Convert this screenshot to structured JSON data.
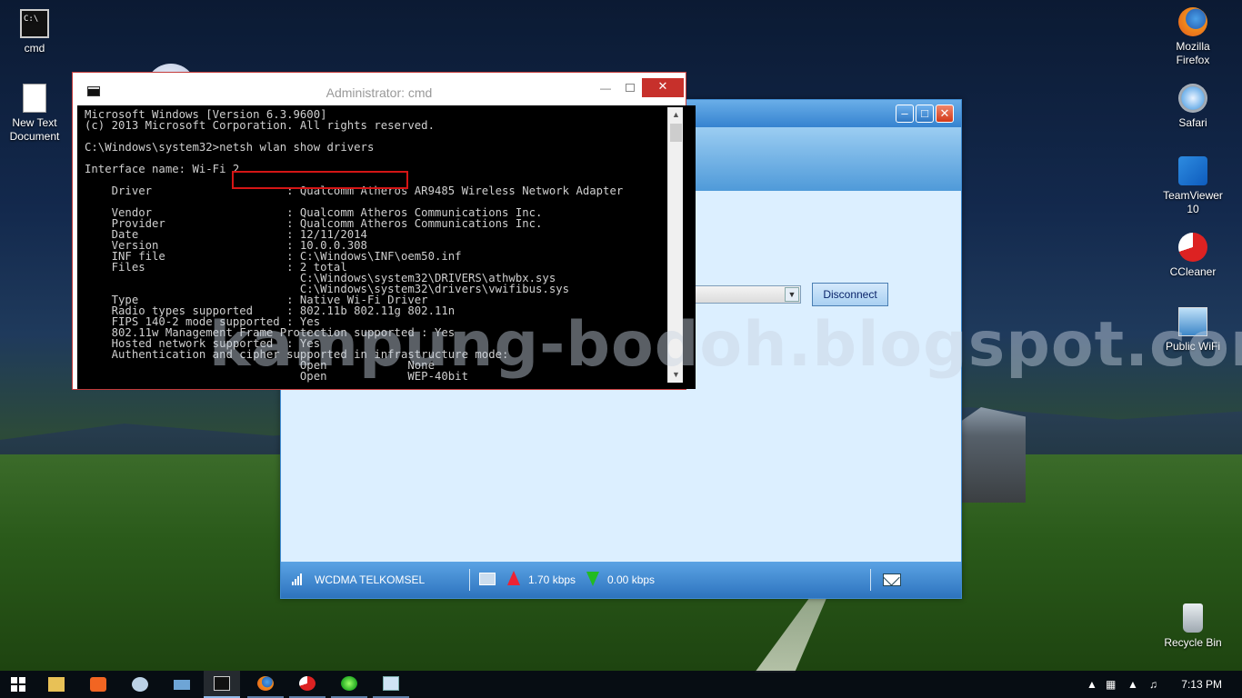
{
  "desktop": {
    "icons": [
      {
        "label": "cmd"
      },
      {
        "label": "New Text Document"
      },
      {
        "label": "Mozilla Firefox"
      },
      {
        "label": "Safari"
      },
      {
        "label": "TeamViewer 10"
      },
      {
        "label": "CCleaner"
      },
      {
        "label": "Public WiFi"
      },
      {
        "label": "Recycle Bin"
      }
    ],
    "watermark": "kampung-bodoh.blogspot.com"
  },
  "cmd_window": {
    "title": "Administrator: cmd",
    "close_label": "✕",
    "console_lines": [
      "Microsoft Windows [Version 6.3.9600]",
      "(c) 2013 Microsoft Corporation. All rights reserved.",
      "",
      "C:\\Windows\\system32>netsh wlan show drivers",
      "",
      "Interface name: Wi-Fi 2",
      "",
      "    Driver                    : Qualcomm Atheros AR9485 Wireless Network Adapter",
      "",
      "    Vendor                    : Qualcomm Atheros Communications Inc.",
      "    Provider                  : Qualcomm Atheros Communications Inc.",
      "    Date                      : 12/11/2014",
      "    Version                   : 10.0.0.308",
      "    INF file                  : C:\\Windows\\INF\\oem50.inf",
      "    Files                     : 2 total",
      "                                C:\\Windows\\system32\\DRIVERS\\athwbx.sys",
      "                                C:\\Windows\\system32\\drivers\\vwifibus.sys",
      "    Type                      : Native Wi-Fi Driver",
      "    Radio types supported     : 802.11b 802.11g 802.11n",
      "    FIPS 140-2 mode supported : Yes",
      "    802.11w Management Frame Protection supported : Yes",
      "    Hosted network supported  : Yes",
      "    Authentication and cipher supported in infrastructure mode:",
      "                                Open            None",
      "                                Open            WEP-40bit"
    ]
  },
  "modem_window": {
    "disconnect_label": "Disconnect",
    "network_name": "WCDMA  TELKOMSEL",
    "upload_speed": "1.70 kbps",
    "download_speed": "0.00 kbps"
  },
  "taskbar": {
    "clock": "7:13 PM"
  }
}
